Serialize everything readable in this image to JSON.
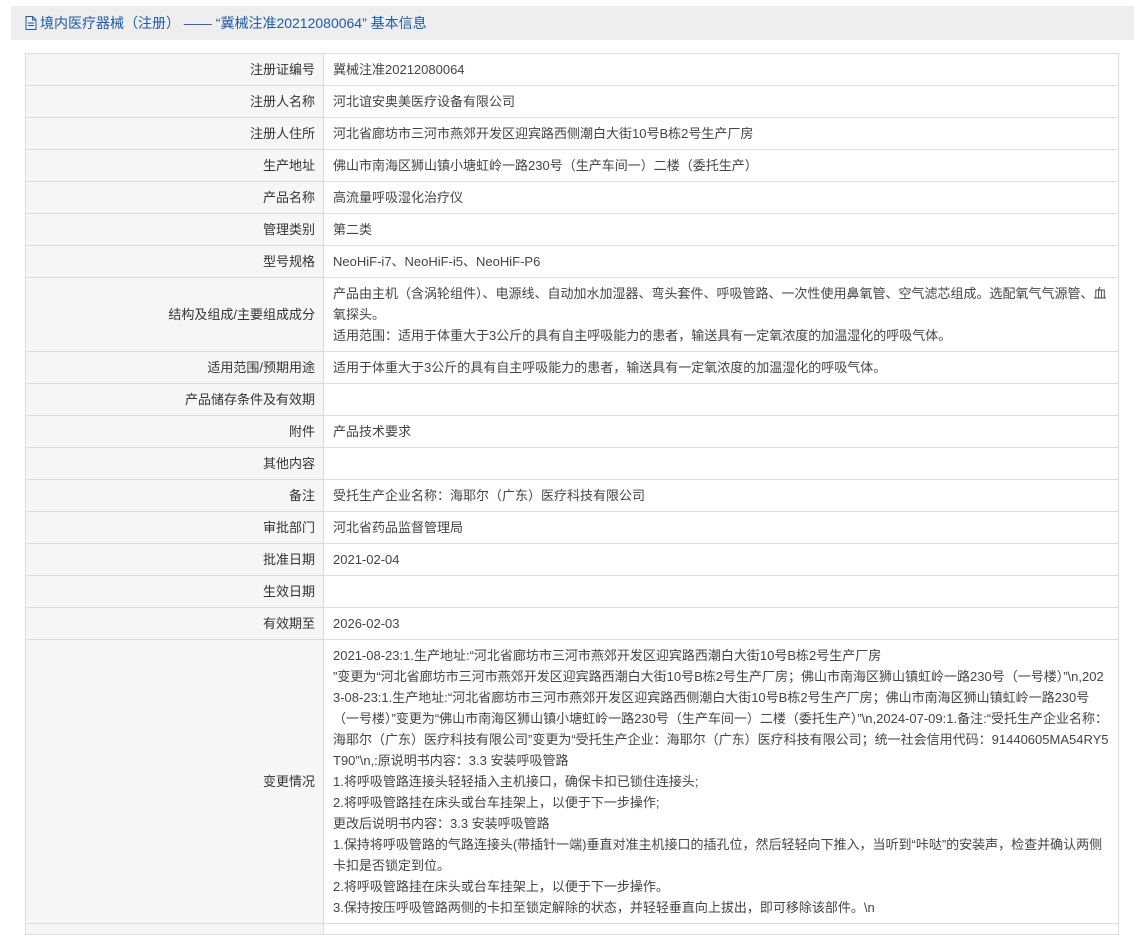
{
  "header": {
    "title": "境内医疗器械（注册） —— “冀械注准20212080064” 基本信息",
    "icon": "document-icon",
    "color": "#1e5aa8"
  },
  "rows": [
    {
      "label": "注册证编号",
      "value": "冀械注准20212080064"
    },
    {
      "label": "注册人名称",
      "value": "河北谊安奥美医疗设备有限公司"
    },
    {
      "label": "注册人住所",
      "value": "河北省廊坊市三河市燕郊开发区迎宾路西侧潮白大街10号B栋2号生产厂房"
    },
    {
      "label": "生产地址",
      "value": "佛山市南海区狮山镇小塘虹岭一路230号（生产车间一）二楼（委托生产）"
    },
    {
      "label": "产品名称",
      "value": "高流量呼吸湿化治疗仪"
    },
    {
      "label": "管理类别",
      "value": "第二类"
    },
    {
      "label": "型号规格",
      "value": "NeoHiF-i7、NeoHiF-i5、NeoHiF-P6"
    },
    {
      "label": "结构及组成/主要组成成分",
      "value": "产品由主机（含涡轮组件）、电源线、自动加水加湿器、弯头套件、呼吸管路、一次性使用鼻氧管、空气滤芯组成。选配氧气气源管、血氧探头。\n适用范围：适用于体重大于3公斤的具有自主呼吸能力的患者，输送具有一定氧浓度的加温湿化的呼吸气体。"
    },
    {
      "label": "适用范围/预期用途",
      "value": "适用于体重大于3公斤的具有自主呼吸能力的患者，输送具有一定氧浓度的加温湿化的呼吸气体。"
    },
    {
      "label": "产品储存条件及有效期",
      "value": ""
    },
    {
      "label": "附件",
      "value": "产品技术要求"
    },
    {
      "label": "其他内容",
      "value": ""
    },
    {
      "label": "备注",
      "value": "受托生产企业名称：海耶尔（广东）医疗科技有限公司"
    },
    {
      "label": "审批部门",
      "value": "河北省药品监督管理局"
    },
    {
      "label": "批准日期",
      "value": "2021-02-04"
    },
    {
      "label": "生效日期",
      "value": ""
    },
    {
      "label": "有效期至",
      "value": "2026-02-03"
    },
    {
      "label": "变更情况",
      "value": "2021-08-23:1.生产地址:“河北省廊坊市三河市燕郊开发区迎宾路西潮白大街10号B栋2号生产厂房\n”变更为“河北省廊坊市三河市燕郊开发区迎宾路西潮白大街10号B栋2号生产厂房；佛山市南海区狮山镇虹岭一路230号（一号楼）”\\n,2023-08-23:1.生产地址:“河北省廊坊市三河市燕郊开发区迎宾路西侧潮白大街10号B栋2号生产厂房；佛山市南海区狮山镇虹岭一路230号（一号楼）”变更为“佛山市南海区狮山镇小塘虹岭一路230号（生产车间一）二楼（委托生产）”\\n,2024-07-09:1.备注:“受托生产企业名称：海耶尔（广东）医疗科技有限公司”变更为“受托生产企业：海耶尔（广东）医疗科技有限公司；统一社会信用代码：91440605MA54RY5T90”\\n,:原说明书内容：3.3 安装呼吸管路\n1.将呼吸管路连接头轻轻插入主机接口，确保卡扣已锁住连接头;\n2.将呼吸管路挂在床头或台车挂架上，以便于下一步操作;\n更改后说明书内容：3.3 安装呼吸管路\n1.保持将呼吸管路的气路连接头(带插针一端)垂直对准主机接口的插孔位，然后轻轻向下推入，当听到“咔哒”的安装声，检查并确认两侧卡扣是否锁定到位。\n2.将呼吸管路挂在床头或台车挂架上，以便于下一步操作。\n3.保持按压呼吸管路两侧的卡扣至锁定解除的状态，并轻轻垂直向上拔出，即可移除该部件。\\n"
    },
    {
      "label": "",
      "value": ""
    }
  ]
}
